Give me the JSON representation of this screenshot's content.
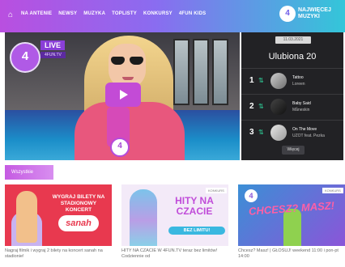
{
  "nav": {
    "items": [
      "NA ANTENIE",
      "NEWSY",
      "MUZYKA",
      "TOPLISTY",
      "KONKURSY",
      "4FUN KIDS"
    ],
    "brand_mark": "4",
    "brand_text": "NAJWIĘCEJ MUZYKI"
  },
  "player": {
    "logo_text": "4",
    "live_label": "LIVE",
    "live_sub": "4FUN.TV"
  },
  "chart": {
    "date": "11.03.2021",
    "title": "Ulubiona 20",
    "rows": [
      {
        "rank": "1",
        "song": "Tattoo",
        "artist": "Loreen"
      },
      {
        "rank": "2",
        "song": "Baby Said",
        "artist": "Måneskin"
      },
      {
        "rank": "3",
        "song": "On The Move",
        "artist": "UZOT feat. Pezka"
      }
    ],
    "more_label": "Więcej"
  },
  "section": {
    "tag": "Wszystkie"
  },
  "cards": [
    {
      "cta": "WYGRAJ BILETY NA STADIONOWY KONCERT",
      "cta_sub": "",
      "brand": "sanah",
      "caption": "Nagraj filmik i wygraj 2 bilety na koncert sanah na stadionie!"
    },
    {
      "label": "KONKURS",
      "headline": "HITY NA CZACIE",
      "mid": "",
      "pill": "BEZ LIMITU!",
      "caption": "HITY NA CZACIE W 4FUN.TV teraz bez limitów! Codziennie od"
    },
    {
      "label": "KONKURS",
      "mark": "4",
      "headline": "CHCESZ? MASZ!",
      "caption": "Chcesz? Masz! | GŁOSUJ! weekend 11:00 i pon-pt 14:00"
    }
  ]
}
